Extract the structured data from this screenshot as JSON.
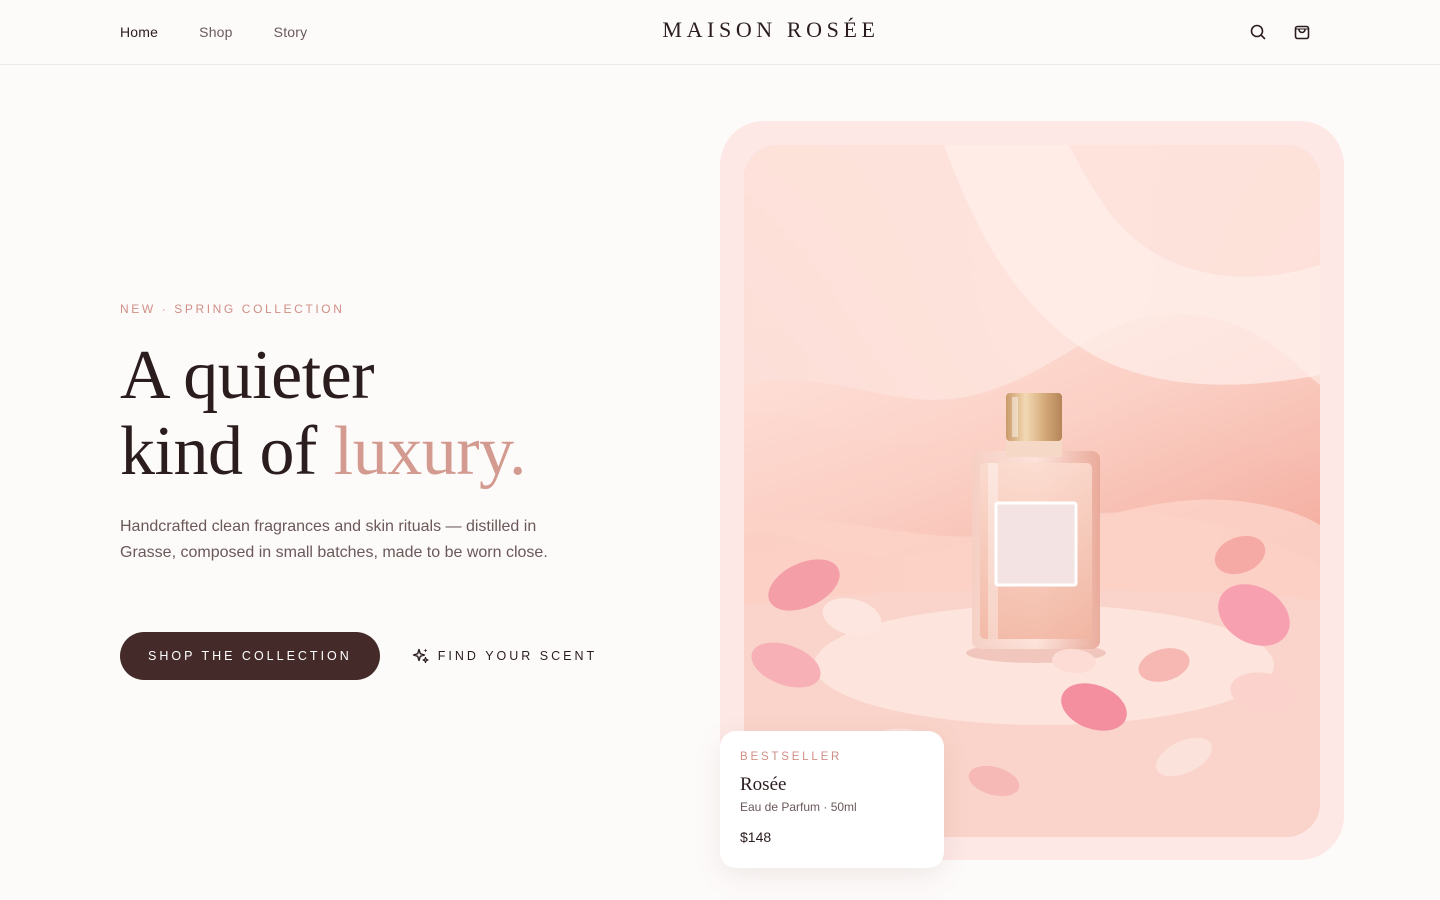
{
  "header": {
    "nav": [
      {
        "label": "Home"
      },
      {
        "label": "Shop"
      },
      {
        "label": "Story"
      }
    ],
    "logo": "MAISON ROSÉE",
    "icons": {
      "search": "search-icon",
      "cart": "shopping-bag-icon"
    }
  },
  "hero": {
    "eyebrow": "NEW · SPRING COLLECTION",
    "headline_line1": "A quieter",
    "headline_line2": "kind of",
    "headline_accent": "luxury.",
    "lede": "Handcrafted clean fragrances and skin rituals — distilled in Grasse, composed in small batches, made to be worn close.",
    "primary_cta": "SHOP THE COLLECTION",
    "secondary_cta": "FIND YOUR SCENT",
    "secondary_icon": "sparkles-icon"
  },
  "product_card": {
    "tag": "BESTSELLER",
    "name": "Rosée",
    "description": "Eau de Parfum · 50ml",
    "price": "$148"
  },
  "colors": {
    "background": "#fdfbfa",
    "ink": "#2b1d1e",
    "accent": "#d39a8f",
    "button": "#452a2a",
    "frame": "#fde8e6"
  }
}
